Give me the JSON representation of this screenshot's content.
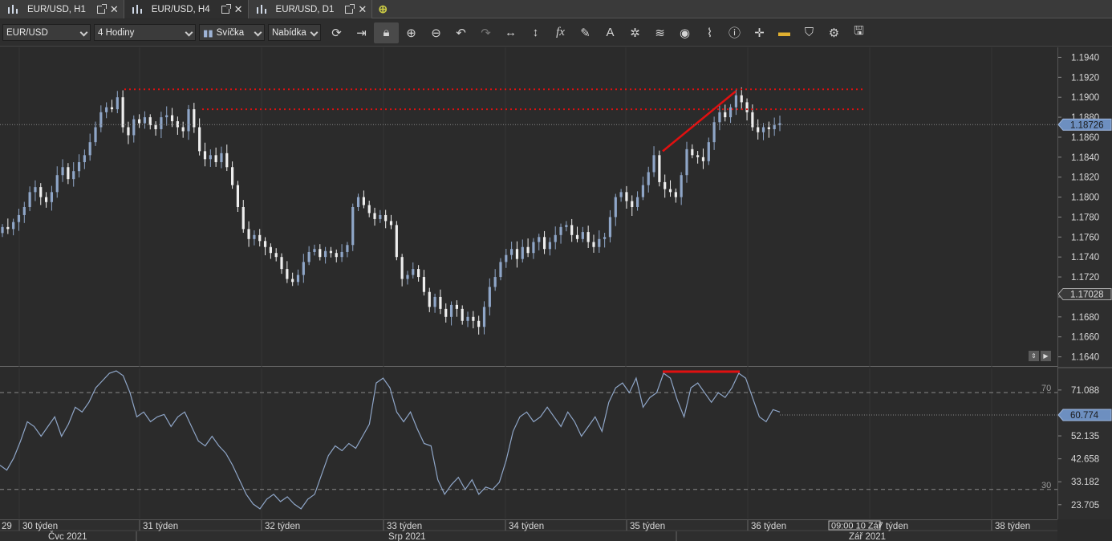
{
  "tabs": [
    {
      "label": "EUR/USD, H1",
      "active": false
    },
    {
      "label": "EUR/USD, H4",
      "active": true
    },
    {
      "label": "EUR/USD, D1",
      "active": false
    }
  ],
  "toolbar": {
    "symbol": "EUR/USD",
    "timeframe": "4 Hodiny",
    "chart_type": "Svíčka",
    "menu": "Nabídka",
    "icons": [
      "refresh-icon",
      "shift-icon",
      "lock-icon",
      "zoom-in-icon",
      "zoom-out-icon",
      "undo-icon",
      "redo-icon",
      "horizontal-scale-icon",
      "vertical-scale-icon",
      "indicator-fx-icon",
      "pencil-icon",
      "text-icon",
      "crosshair-icon",
      "layers-icon",
      "eye-icon",
      "alert-icon",
      "info-icon",
      "cursor-icon",
      "color-icon",
      "paint-bucket-icon",
      "settings-icon",
      "save-icon"
    ]
  },
  "colors": {
    "bull": "#8fa6c8",
    "bear": "#eeeeee",
    "rsi": "#8fa6c8",
    "mark": "#e01010",
    "bg": "#2b2b2b"
  },
  "chart_data": {
    "type": "candlestick",
    "ylim": [
      1.163,
      1.195
    ],
    "price_ticks": [
      "1.1940",
      "1.1920",
      "1.1900",
      "1.1880",
      "1.1860",
      "1.1840",
      "1.1820",
      "1.1800",
      "1.1780",
      "1.1760",
      "1.1740",
      "1.1720",
      "1.1700",
      "1.1680",
      "1.1660",
      "1.1640"
    ],
    "current_price": "1.18726",
    "marked_price": "1.17028",
    "levels": [
      1.1908,
      1.1888
    ],
    "close_series": [
      1.177,
      1.1768,
      1.1775,
      1.1782,
      1.179,
      1.1805,
      1.181,
      1.18,
      1.1795,
      1.1805,
      1.1822,
      1.183,
      1.1818,
      1.1826,
      1.1835,
      1.1842,
      1.1855,
      1.187,
      1.1885,
      1.189,
      1.1888,
      1.19,
      1.187,
      1.1862,
      1.1878,
      1.1874,
      1.188,
      1.1872,
      1.1868,
      1.188,
      1.1882,
      1.1876,
      1.187,
      1.1866,
      1.1888,
      1.187,
      1.1846,
      1.1838,
      1.1842,
      1.1835,
      1.1844,
      1.183,
      1.1812,
      1.179,
      1.1768,
      1.1758,
      1.1762,
      1.1756,
      1.175,
      1.1744,
      1.174,
      1.1728,
      1.1718,
      1.1715,
      1.1722,
      1.1735,
      1.1745,
      1.1748,
      1.174,
      1.1746,
      1.1744,
      1.174,
      1.1745,
      1.1752,
      1.179,
      1.18,
      1.1792,
      1.1784,
      1.1778,
      1.1782,
      1.1776,
      1.1772,
      1.174,
      1.1718,
      1.1722,
      1.1728,
      1.172,
      1.1705,
      1.169,
      1.17,
      1.1688,
      1.168,
      1.1692,
      1.1688,
      1.1676,
      1.168,
      1.1676,
      1.167,
      1.169,
      1.171,
      1.172,
      1.1735,
      1.1742,
      1.1748,
      1.1738,
      1.175,
      1.1744,
      1.1755,
      1.176,
      1.1748,
      1.1755,
      1.1762,
      1.177,
      1.1772,
      1.1762,
      1.1758,
      1.1765,
      1.1755,
      1.175,
      1.1758,
      1.176,
      1.178,
      1.18,
      1.1805,
      1.1796,
      1.179,
      1.18,
      1.1812,
      1.1825,
      1.1842,
      1.1815,
      1.1808,
      1.1805,
      1.18,
      1.1822,
      1.1848,
      1.1842,
      1.184,
      1.1836,
      1.1855,
      1.1875,
      1.1885,
      1.188,
      1.189,
      1.1902,
      1.1895,
      1.1885,
      1.187,
      1.1865,
      1.187,
      1.1868,
      1.1872,
      1.1874
    ],
    "rsi": {
      "levels_labels": [
        "70",
        "30"
      ],
      "ticks": [
        "71.088",
        "52.135",
        "42.658",
        "33.182",
        "23.705"
      ],
      "current": "60.774",
      "values": [
        40,
        38,
        43,
        50,
        58,
        56,
        52,
        56,
        60,
        52,
        57,
        64,
        62,
        66,
        72,
        75,
        78,
        79,
        77,
        70,
        60,
        62,
        58,
        60,
        61,
        56,
        60,
        62,
        56,
        50,
        48,
        52,
        48,
        45,
        40,
        34,
        28,
        24,
        22,
        26,
        28,
        25,
        27,
        24,
        22,
        26,
        28,
        36,
        44,
        48,
        46,
        49,
        47,
        52,
        57,
        74,
        76,
        72,
        62,
        58,
        62,
        55,
        49,
        48,
        34,
        28,
        32,
        35,
        30,
        34,
        28,
        31,
        30,
        33,
        42,
        54,
        60,
        62,
        58,
        60,
        64,
        60,
        56,
        62,
        58,
        52,
        56,
        60,
        54,
        66,
        72,
        74,
        70,
        76,
        64,
        68,
        70,
        78,
        76,
        67,
        60,
        72,
        74,
        70,
        66,
        70,
        68,
        72,
        78,
        76,
        68,
        60,
        58,
        63,
        62
      ]
    },
    "x_ticks": [
      "29",
      "30 týden",
      "31 týden",
      "32 týden",
      "33 týden",
      "34 týden",
      "35 týden",
      "36 týden",
      "37 týden",
      "38 týden"
    ],
    "months": [
      "Čvc 2021",
      "Srp 2021",
      "Zář 2021"
    ],
    "crosshair_time": "09:00 10 Zář"
  }
}
